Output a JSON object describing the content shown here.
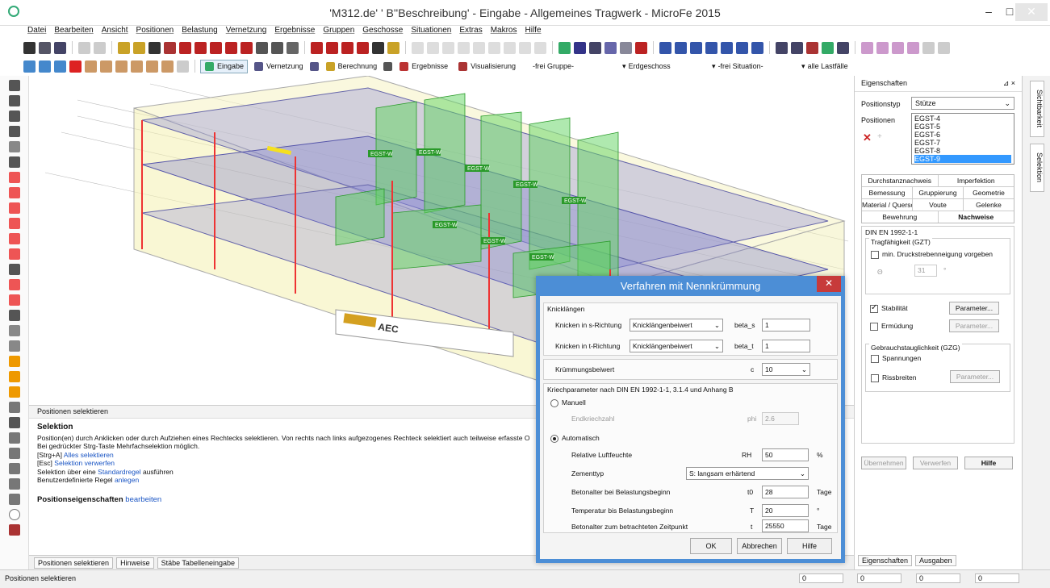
{
  "window": {
    "title": "'M312.de' ' B''Beschreibung' - Eingabe - Allgemeines Tragwerk - MicroFe 2015",
    "minimize": "–",
    "maximize": "□",
    "close": "✕"
  },
  "menu": [
    "Datei",
    "Bearbeiten",
    "Ansicht",
    "Positionen",
    "Belastung",
    "Vernetzung",
    "Ergebnisse",
    "Gruppen",
    "Geschosse",
    "Situationen",
    "Extras",
    "Makros",
    "Hilfe"
  ],
  "toolbar2": {
    "tabs": [
      "Eingabe",
      "Vernetzung",
      "Berechnung",
      "Ergebnisse",
      "Visualisierung"
    ],
    "dropdowns": [
      "-frei Gruppe-",
      "Erdgeschoss",
      "-frei Situation-",
      "alle Lastfälle"
    ]
  },
  "lower_panel": {
    "header": "Positionen selektieren",
    "title": "Selektion",
    "lines": [
      "Position(en) durch Anklicken oder durch Aufziehen eines Rechtecks selektieren. Von rechts nach links aufgezogenes Rechteck selektiert auch teilweise erfasste O",
      "Bei gedrückter Strg-Taste Mehrfachselektion möglich."
    ],
    "strg_prefix": "[Strg+A]",
    "strg_link": "Alles selektieren",
    "esc_prefix": "[Esc]",
    "esc_link": "Selektion verwerfen",
    "regel_prefix": "Selektion über eine",
    "regel_link": "Standardregel",
    "regel_suffix": "ausführen",
    "benutzer_prefix": "Benutzerdefinierte Regel",
    "benutzer_link": "anlegen",
    "pos_bold": "Positionseigenschaften",
    "pos_link": "bearbeiten"
  },
  "bottom_tabs": [
    "Positionen selektieren",
    "Hinweise",
    "Stäbe Tabelleneingabe"
  ],
  "status": {
    "text": "Positionen selektieren",
    "dx": "0",
    "dy": "0",
    "dz": "0",
    "dzz": "0"
  },
  "properties": {
    "title": "Eigenschaften",
    "pin": "⊿ ×",
    "positionstyp_label": "Positionstyp",
    "positionstyp_value": "Stütze",
    "positionen_label": "Positionen",
    "positionen": [
      "EGST-4",
      "EGST-5",
      "EGST-6",
      "EGST-7",
      "EGST-8",
      "EGST-9"
    ],
    "tabs_row1": [
      "Durchstanznachweis",
      "Imperfektion"
    ],
    "tabs_row2": [
      "Bemessung",
      "Gruppierung",
      "Geometrie"
    ],
    "tabs_row3": [
      "Material / Querschnitt",
      "Voute",
      "Gelenke"
    ],
    "tabs_row4": [
      "Bewehrung",
      "Nachweise"
    ],
    "norm": "DIN EN 1992-1-1",
    "gzt": "Tragfähigkeit (GZT)",
    "min_druck": "min. Druckstrebenneigung vorgeben",
    "theta_sym": "Θ",
    "theta_val": "31",
    "theta_unit": "°",
    "stabilitaet": "Stabilität",
    "parameter": "Parameter...",
    "ermuedung": "Ermüdung",
    "gzg": "Gebrauchstauglichkeit (GZG)",
    "spannungen": "Spannungen",
    "rissbreiten": "Rissbreiten",
    "btn_uebernehmen": "Übernehmen",
    "btn_verwerfen": "Verwerfen",
    "btn_hilfe": "Hilfe",
    "bottom_tabs": [
      "Eigenschaften",
      "Ausgaben"
    ]
  },
  "vertical_tabs": [
    "Sichtbarkeit",
    "Selektion"
  ],
  "dialog": {
    "title": "Verfahren mit Nennkrümmung",
    "close": "✕",
    "knick_group": "Knicklängen",
    "knick_s_label": "Knicken in s-Richtung",
    "knick_s_sel": "Knicklängenbeiwert",
    "beta_s_label": "beta_s",
    "beta_s_val": "1",
    "knick_t_label": "Knicken in t-Richtung",
    "knick_t_sel": "Knicklängenbeiwert",
    "beta_t_label": "beta_t",
    "beta_t_val": "1",
    "kruemmung_label": "Krümmungsbeiwert",
    "c_label": "c",
    "c_val": "10",
    "kriech_group": "Kriechparameter nach DIN EN 1992-1-1, 3.1.4 und Anhang B",
    "manuell": "Manuell",
    "endkriech": "Endkriechzahl",
    "phi_label": "phi",
    "phi_val": "2.6",
    "auto": "Automatisch",
    "rh_label": "Relative Luftfeuchte",
    "rh_sym": "RH",
    "rh_val": "50",
    "rh_unit": "%",
    "zement_label": "Zementtyp",
    "zement_val": "S: langsam erhärtend",
    "t0_label": "Betonalter bei Belastungsbeginn",
    "t0_sym": "t0",
    "t0_val": "28",
    "t0_unit": "Tage",
    "temp_label": "Temperatur bis Belastungsbeginn",
    "temp_sym": "T",
    "temp_val": "20",
    "temp_unit": "°",
    "t_label": "Betonalter zum betrachteten Zeitpunkt",
    "t_sym": "t",
    "t_val": "25550",
    "t_unit": "Tage",
    "ok": "OK",
    "abbrechen": "Abbrechen",
    "hilfe": "Hilfe"
  },
  "model": {
    "node_label": "EGST-W",
    "logo_text": "AEC"
  }
}
